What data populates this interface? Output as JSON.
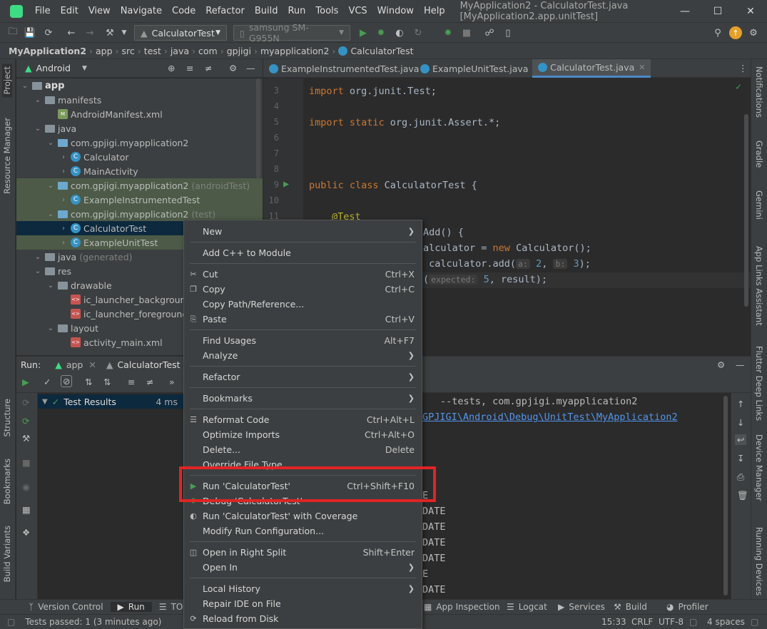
{
  "titlebar": {
    "menus": [
      "File",
      "Edit",
      "View",
      "Navigate",
      "Code",
      "Refactor",
      "Build",
      "Run",
      "Tools",
      "VCS",
      "Window",
      "Help"
    ],
    "title": "MyApplication2 - CalculatorTest.java [MyApplication2.app.unitTest]"
  },
  "toolbar": {
    "run_config": "CalculatorTest",
    "device": "samsung SM-G955N"
  },
  "breadcrumb": [
    "MyApplication2",
    "app",
    "src",
    "test",
    "java",
    "com",
    "gpjigi",
    "myapplication2",
    "CalculatorTest"
  ],
  "left_tools": [
    "Project",
    "Resource Manager",
    "Structure",
    "Bookmarks",
    "Build Variants"
  ],
  "right_tools": [
    "Notifications",
    "Gradle",
    "Gemini",
    "App Links Assistant",
    "Flutter Deep Links",
    "Device Manager",
    "Running Devices"
  ],
  "project": {
    "view": "Android",
    "tree": [
      {
        "label": "app",
        "depth": 0,
        "icon": "folder",
        "bold": true
      },
      {
        "label": "manifests",
        "depth": 1,
        "icon": "folder"
      },
      {
        "label": "AndroidManifest.xml",
        "depth": 2,
        "icon": "manifest"
      },
      {
        "label": "java",
        "depth": 1,
        "icon": "folder"
      },
      {
        "label": "com.gpjigi.myapplication2",
        "depth": 2,
        "icon": "folder"
      },
      {
        "label": "Calculator",
        "depth": 3,
        "icon": "class"
      },
      {
        "label": "MainActivity",
        "depth": 3,
        "icon": "class"
      },
      {
        "label": "com.gpjigi.myapplication2",
        "suffix": "(androidTest)",
        "depth": 2,
        "icon": "folder"
      },
      {
        "label": "ExampleInstrumentedTest",
        "depth": 3,
        "icon": "class"
      },
      {
        "label": "com.gpjigi.myapplication2",
        "suffix": "(test)",
        "depth": 2,
        "icon": "folder"
      },
      {
        "label": "CalculatorTest",
        "depth": 3,
        "icon": "class"
      },
      {
        "label": "ExampleUnitTest",
        "depth": 3,
        "icon": "class"
      },
      {
        "label": "java",
        "suffix": "(generated)",
        "depth": 1,
        "icon": "folder"
      },
      {
        "label": "res",
        "depth": 1,
        "icon": "folder"
      },
      {
        "label": "drawable",
        "depth": 2,
        "icon": "folder"
      },
      {
        "label": "ic_launcher_background.x",
        "depth": 3,
        "icon": "xml"
      },
      {
        "label": "ic_launcher_foreground.x",
        "depth": 3,
        "icon": "xml"
      },
      {
        "label": "layout",
        "depth": 2,
        "icon": "folder"
      },
      {
        "label": "activity_main.xml",
        "depth": 3,
        "icon": "xml"
      }
    ]
  },
  "editor_tabs": [
    "ExampleInstrumentedTest.java",
    "ExampleUnitTest.java",
    "CalculatorTest.java"
  ],
  "code": {
    "line_numbers": [
      "3",
      "4",
      "5",
      "6",
      "7",
      "8",
      "9",
      "10",
      "11"
    ],
    "import1_kw": "import",
    "import1_rest": " org.junit.Test;",
    "import2_kw": "import static",
    "import2_rest": " org.junit.Assert.*;",
    "class_kw": "public class",
    "class_rest": " CalculatorTest {",
    "annotation": "@Test",
    "l13": "Add() {",
    "l14a": "alculator = ",
    "l14kw": "new",
    "l14b": " Calculator();",
    "l15a": " calculator.add(",
    "l15h1": "a:",
    "l15n1": "2",
    "l15m": ", ",
    "l15h2": "b:",
    "l15n2": "3",
    "l15e": ");",
    "l16a": "(",
    "l16h": "expected:",
    "l16n": "5",
    "l16e": ", result);"
  },
  "run": {
    "label": "Run:",
    "config1": "app",
    "config2": "CalculatorTest",
    "test_results": "Test Results",
    "duration": "4 ms",
    "console_line1": "--tests, com.gpjigi.myapplication2",
    "console_link": "GPJIGI\\Android\\Debug\\UnitTest\\MyApplication2",
    "console_tail": [
      "E",
      "DATE",
      "DATE",
      "DATE",
      "DATE",
      "E",
      "DATE"
    ]
  },
  "context_menu": [
    {
      "label": "New",
      "submenu": true,
      "icon": ""
    },
    {
      "sep": true
    },
    {
      "label": "Add C++ to Module",
      "icon": ""
    },
    {
      "sep": true
    },
    {
      "label": "Cut",
      "shortcut": "Ctrl+X",
      "icon": "cut-icon"
    },
    {
      "label": "Copy",
      "shortcut": "Ctrl+C",
      "icon": "copy-icon"
    },
    {
      "label": "Copy Path/Reference...",
      "icon": ""
    },
    {
      "label": "Paste",
      "shortcut": "Ctrl+V",
      "icon": "paste-icon"
    },
    {
      "sep": true
    },
    {
      "label": "Find Usages",
      "shortcut": "Alt+F7",
      "icon": ""
    },
    {
      "label": "Analyze",
      "submenu": true,
      "icon": ""
    },
    {
      "sep": true
    },
    {
      "label": "Refactor",
      "submenu": true,
      "icon": ""
    },
    {
      "sep": true
    },
    {
      "label": "Bookmarks",
      "submenu": true,
      "icon": ""
    },
    {
      "sep": true
    },
    {
      "label": "Reformat Code",
      "shortcut": "Ctrl+Alt+L",
      "icon": "reformat-icon"
    },
    {
      "label": "Optimize Imports",
      "shortcut": "Ctrl+Alt+O",
      "icon": ""
    },
    {
      "label": "Delete...",
      "shortcut": "Delete",
      "icon": ""
    },
    {
      "label": "Override File Type",
      "icon": ""
    },
    {
      "sep": true
    },
    {
      "label": "Run 'CalculatorTest'",
      "shortcut": "Ctrl+Shift+F10",
      "icon": "run-icon"
    },
    {
      "label": "Debug 'CalculatorTest'",
      "icon": "debug-icon"
    },
    {
      "label": "Run 'CalculatorTest' with Coverage",
      "icon": "coverage-icon"
    },
    {
      "label": "Modify Run Configuration...",
      "icon": ""
    },
    {
      "sep": true
    },
    {
      "label": "Open in Right Split",
      "shortcut": "Shift+Enter",
      "icon": "split-icon"
    },
    {
      "label": "Open In",
      "submenu": true,
      "icon": ""
    },
    {
      "sep": true
    },
    {
      "label": "Local History",
      "submenu": true,
      "icon": ""
    },
    {
      "label": "Repair IDE on File",
      "icon": ""
    },
    {
      "label": "Reload from Disk",
      "icon": "reload-icon"
    }
  ],
  "bottom_tabs": [
    "Version Control",
    "Run",
    "TODO",
    "App Inspection",
    "Logcat",
    "Services",
    "Build",
    "Profiler"
  ],
  "status": {
    "message": "Tests passed: 1 (3 minutes ago)",
    "position": "15:33",
    "line_sep": "CRLF",
    "encoding": "UTF-8",
    "indent": "4 spaces"
  },
  "colors": {
    "accent": "#4a88c7",
    "highlight_box": "#e02424",
    "run_green": "#499c54"
  }
}
